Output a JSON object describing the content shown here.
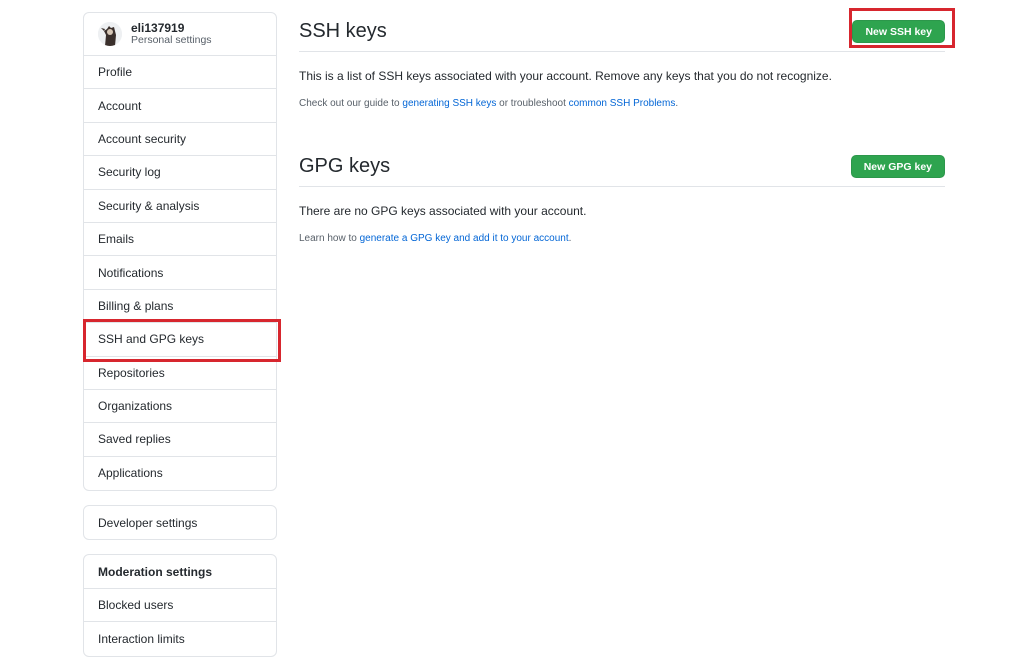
{
  "sidebar": {
    "user": {
      "name": "eli137919",
      "subtitle": "Personal settings"
    },
    "items": [
      {
        "label": "Profile"
      },
      {
        "label": "Account"
      },
      {
        "label": "Account security"
      },
      {
        "label": "Security log"
      },
      {
        "label": "Security & analysis"
      },
      {
        "label": "Emails"
      },
      {
        "label": "Notifications"
      },
      {
        "label": "Billing & plans"
      },
      {
        "label": "SSH and GPG keys",
        "selected": true
      },
      {
        "label": "Repositories"
      },
      {
        "label": "Organizations"
      },
      {
        "label": "Saved replies"
      },
      {
        "label": "Applications"
      }
    ],
    "developer": {
      "label": "Developer settings"
    },
    "moderation": {
      "heading": "Moderation settings",
      "items": [
        {
          "label": "Blocked users"
        },
        {
          "label": "Interaction limits"
        }
      ]
    }
  },
  "ssh": {
    "title": "SSH keys",
    "button": "New SSH key",
    "description": "This is a list of SSH keys associated with your account. Remove any keys that you do not recognize.",
    "guide_prefix": "Check out our guide to ",
    "guide_link": "generating SSH keys",
    "guide_middle": " or troubleshoot ",
    "guide_link2": "common SSH Problems",
    "guide_suffix": "."
  },
  "gpg": {
    "title": "GPG keys",
    "button": "New GPG key",
    "description": "There are no GPG keys associated with your account.",
    "learn_prefix": "Learn how to ",
    "learn_link": "generate a GPG key and add it to your account",
    "learn_suffix": "."
  },
  "colors": {
    "accent_green": "#2ea44f",
    "link_blue": "#0366d6",
    "highlight_red": "#d7262e"
  }
}
